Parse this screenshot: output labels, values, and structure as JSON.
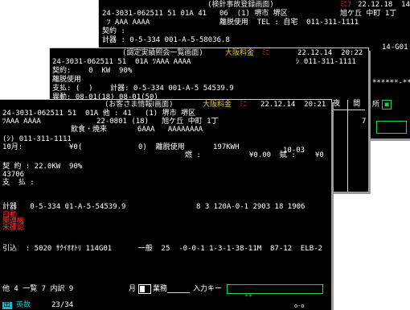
{
  "back_window": {
    "title": "(検針事故登録画面)",
    "datetime": "22.12.18  14:",
    "red_mark": "ﾐﾆﾌ",
    "row1_id": "24-3031-062511 51 01A 41",
    "row1_mid": "06  (1) 堺市 堺区",
    "row1_right": "旭ケ丘 中町 1丁",
    "row2_left": "ﾂ AAA AAAA",
    "row2_mid": "離脱使用  TEL : 自宅  011-311-1111",
    "row3_left": "契約 :",
    "row4_left": "計器 : 0-5-334 001-A-5-58036.8",
    "right_code": "14-G01",
    "right_dots": "******-**",
    "right_label": "所",
    "right_box_char": "■"
  },
  "mid_window": {
    "title": "(調定実績照会一覧画面)",
    "branch": "大阪料金",
    "branch_red": "ﾐﾆ",
    "datetime": "22.12.14  20:22",
    "row1": "24-3031-062511 51  01A ﾂAAA AAAA",
    "row1_right": "ｼ 011-311-1111",
    "row2": "契約:    0  KW  90%",
    "row3": "離脱使用",
    "row4": "支払: (  )    計器: 0-5-334 001-A-5 54539.9",
    "row5": "異動: 08-01(18) 08-01(50)",
    "col_headers": "夜   間",
    "side_num": "7"
  },
  "front_window": {
    "title": "(お客さま情報Ⅰ画面)",
    "branch": "大阪料金",
    "branch_red": "ﾐﾆ",
    "datetime": "22.12.14  20:21",
    "row1": "24-3031-062511 51  01A 他 : 41   (1) 堺市 堺区",
    "row2_left": "ﾂAAA AAAA",
    "row2_mid": "22-0801 (18)   旭ケ丘 中町 1丁",
    "row3": "飲食・焼来       6AAA   AAAAAAAA",
    "row4": "(ｼ) 011-311-1111",
    "row5_left": "10月:",
    "row5_a": "¥0(",
    "row5_b": "0)  離脱使用",
    "row5_c": "197KWH",
    "row5_d": "10-03",
    "row6_a": "燃 :",
    "row6_b": "¥0.00  賦 :",
    "row6_c": "¥0",
    "row7": "契 約 : 22.0KW  90%",
    "row8": "43706",
    "row9": "支  払 :",
    "row10": "計器   0-5-334 01-A-5-54539.9",
    "row10_right": "8 3 120A-0-1 2903 18 1906",
    "red1": "自動",
    "red2": "関連機",
    "red3": "未確認",
    "row11": "引込  : 5020 ｻｸｲｵｵﾄﾘ 114G01      一般  25  -0-0-1 1-3-1-38-11M  87-12  ELB-2",
    "bottom_left": "他 4 一覧 7 内訳 9",
    "month_label": "月",
    "work_label": "業務",
    "input_label": "入力キー",
    "input_value": "**",
    "status_a": "出",
    "status_b": "英数",
    "status_page": "23/34",
    "status_right": "o-o"
  }
}
